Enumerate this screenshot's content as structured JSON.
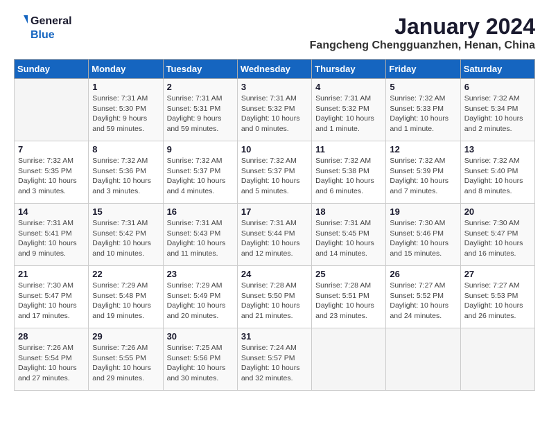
{
  "header": {
    "logo_general": "General",
    "logo_blue": "Blue",
    "month_year": "January 2024",
    "location": "Fangcheng Chengguanzhen, Henan, China"
  },
  "weekdays": [
    "Sunday",
    "Monday",
    "Tuesday",
    "Wednesday",
    "Thursday",
    "Friday",
    "Saturday"
  ],
  "weeks": [
    [
      {
        "day": "",
        "info": ""
      },
      {
        "day": "1",
        "info": "Sunrise: 7:31 AM\nSunset: 5:30 PM\nDaylight: 9 hours\nand 59 minutes."
      },
      {
        "day": "2",
        "info": "Sunrise: 7:31 AM\nSunset: 5:31 PM\nDaylight: 9 hours\nand 59 minutes."
      },
      {
        "day": "3",
        "info": "Sunrise: 7:31 AM\nSunset: 5:32 PM\nDaylight: 10 hours\nand 0 minutes."
      },
      {
        "day": "4",
        "info": "Sunrise: 7:31 AM\nSunset: 5:32 PM\nDaylight: 10 hours\nand 1 minute."
      },
      {
        "day": "5",
        "info": "Sunrise: 7:32 AM\nSunset: 5:33 PM\nDaylight: 10 hours\nand 1 minute."
      },
      {
        "day": "6",
        "info": "Sunrise: 7:32 AM\nSunset: 5:34 PM\nDaylight: 10 hours\nand 2 minutes."
      }
    ],
    [
      {
        "day": "7",
        "info": "Sunrise: 7:32 AM\nSunset: 5:35 PM\nDaylight: 10 hours\nand 3 minutes."
      },
      {
        "day": "8",
        "info": "Sunrise: 7:32 AM\nSunset: 5:36 PM\nDaylight: 10 hours\nand 3 minutes."
      },
      {
        "day": "9",
        "info": "Sunrise: 7:32 AM\nSunset: 5:37 PM\nDaylight: 10 hours\nand 4 minutes."
      },
      {
        "day": "10",
        "info": "Sunrise: 7:32 AM\nSunset: 5:37 PM\nDaylight: 10 hours\nand 5 minutes."
      },
      {
        "day": "11",
        "info": "Sunrise: 7:32 AM\nSunset: 5:38 PM\nDaylight: 10 hours\nand 6 minutes."
      },
      {
        "day": "12",
        "info": "Sunrise: 7:32 AM\nSunset: 5:39 PM\nDaylight: 10 hours\nand 7 minutes."
      },
      {
        "day": "13",
        "info": "Sunrise: 7:32 AM\nSunset: 5:40 PM\nDaylight: 10 hours\nand 8 minutes."
      }
    ],
    [
      {
        "day": "14",
        "info": "Sunrise: 7:31 AM\nSunset: 5:41 PM\nDaylight: 10 hours\nand 9 minutes."
      },
      {
        "day": "15",
        "info": "Sunrise: 7:31 AM\nSunset: 5:42 PM\nDaylight: 10 hours\nand 10 minutes."
      },
      {
        "day": "16",
        "info": "Sunrise: 7:31 AM\nSunset: 5:43 PM\nDaylight: 10 hours\nand 11 minutes."
      },
      {
        "day": "17",
        "info": "Sunrise: 7:31 AM\nSunset: 5:44 PM\nDaylight: 10 hours\nand 12 minutes."
      },
      {
        "day": "18",
        "info": "Sunrise: 7:31 AM\nSunset: 5:45 PM\nDaylight: 10 hours\nand 14 minutes."
      },
      {
        "day": "19",
        "info": "Sunrise: 7:30 AM\nSunset: 5:46 PM\nDaylight: 10 hours\nand 15 minutes."
      },
      {
        "day": "20",
        "info": "Sunrise: 7:30 AM\nSunset: 5:47 PM\nDaylight: 10 hours\nand 16 minutes."
      }
    ],
    [
      {
        "day": "21",
        "info": "Sunrise: 7:30 AM\nSunset: 5:47 PM\nDaylight: 10 hours\nand 17 minutes."
      },
      {
        "day": "22",
        "info": "Sunrise: 7:29 AM\nSunset: 5:48 PM\nDaylight: 10 hours\nand 19 minutes."
      },
      {
        "day": "23",
        "info": "Sunrise: 7:29 AM\nSunset: 5:49 PM\nDaylight: 10 hours\nand 20 minutes."
      },
      {
        "day": "24",
        "info": "Sunrise: 7:28 AM\nSunset: 5:50 PM\nDaylight: 10 hours\nand 21 minutes."
      },
      {
        "day": "25",
        "info": "Sunrise: 7:28 AM\nSunset: 5:51 PM\nDaylight: 10 hours\nand 23 minutes."
      },
      {
        "day": "26",
        "info": "Sunrise: 7:27 AM\nSunset: 5:52 PM\nDaylight: 10 hours\nand 24 minutes."
      },
      {
        "day": "27",
        "info": "Sunrise: 7:27 AM\nSunset: 5:53 PM\nDaylight: 10 hours\nand 26 minutes."
      }
    ],
    [
      {
        "day": "28",
        "info": "Sunrise: 7:26 AM\nSunset: 5:54 PM\nDaylight: 10 hours\nand 27 minutes."
      },
      {
        "day": "29",
        "info": "Sunrise: 7:26 AM\nSunset: 5:55 PM\nDaylight: 10 hours\nand 29 minutes."
      },
      {
        "day": "30",
        "info": "Sunrise: 7:25 AM\nSunset: 5:56 PM\nDaylight: 10 hours\nand 30 minutes."
      },
      {
        "day": "31",
        "info": "Sunrise: 7:24 AM\nSunset: 5:57 PM\nDaylight: 10 hours\nand 32 minutes."
      },
      {
        "day": "",
        "info": ""
      },
      {
        "day": "",
        "info": ""
      },
      {
        "day": "",
        "info": ""
      }
    ]
  ]
}
